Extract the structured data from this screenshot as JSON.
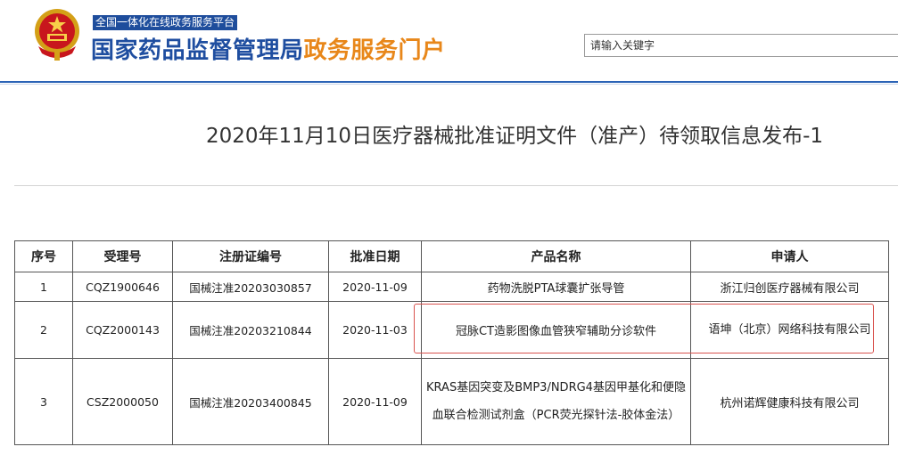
{
  "header": {
    "platform_tag": "全国一体化在线政务服务平台",
    "title_main": "国家药品监督管理局",
    "title_accent": "政务服务门户",
    "search_placeholder": "请输入关键字"
  },
  "article": {
    "title": "2020年11月10日医疗器械批准证明文件（准产）待领取信息发布-1"
  },
  "table": {
    "headers": [
      "序号",
      "受理号",
      "注册证编号",
      "批准日期",
      "产品名称",
      "申请人"
    ],
    "rows": [
      [
        "1",
        "CQZ1900646",
        "国械注准20203030857",
        "2020-11-09",
        "药物洗脱PTA球囊扩张导管",
        "浙江归创医疗器械有限公司"
      ],
      [
        "2",
        "CQZ2000143",
        "国械注准20203210844",
        "2020-11-03",
        "冠脉CT造影图像血管狭窄辅助分诊软件",
        "语坤（北京）网络科技有限公司"
      ],
      [
        "3",
        "CSZ2000050",
        "国械注准20203400845",
        "2020-11-09",
        "KRAS基因突变及BMP3/NDRG4基因甲基化和便隐血联合检测试剂盒（PCR荧光探针法-胶体金法）",
        "杭州诺辉健康科技有限公司"
      ]
    ]
  },
  "colors": {
    "brand_blue": "#1f4ea0",
    "accent_orange": "#e8871a",
    "highlight_red": "#d9534f"
  },
  "icons": {
    "emblem": "national-emblem-icon"
  }
}
